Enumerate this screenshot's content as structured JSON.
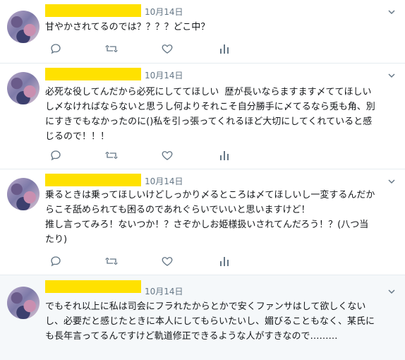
{
  "tweets": [
    {
      "date": "10月14日",
      "text": "甘やかされてるのでは？？？？どこ中？"
    },
    {
      "date": "10月14日",
      "text": "必死な役してんだから必死にしててほしい  歴が長いならますます〆ててほしい\nし〆なければならないと思うし何よりそれこそ自分勝手に〆てるなら兎も角、別\nにすきでもなかったのに()私を引っ張ってくれるほど大切にしてくれていると感\nじるので！！！"
    },
    {
      "date": "10月14日",
      "text": "乗るときは乗ってほしいけどしっかり〆るところは〆てほしいし一変するんだか\nらこそ舐められても困るのであれぐらいでいいと思いますけど！\n推し言ってみろ！ないつか！？さぞかしお姫様扱いされてんだろう！？(八つ当\nたり)"
    },
    {
      "date": "10月14日",
      "text": "でもそれ以上に私は司会にフラれたからとかで安くファンサはして欲しくない\nし、必要だと感じたときに本人にしてもらいたいし、媚びることもなく、某氏に\nも長年言ってるんですけど軌道修正できるような人がすきなので………"
    }
  ],
  "icons": {
    "reply": "reply-icon",
    "retweet": "retweet-icon",
    "like": "like-icon",
    "analytics": "analytics-icon",
    "menu": "chevron-down-icon"
  },
  "colors": {
    "name_redaction": "#ffe100",
    "icon": "#657786",
    "border": "#e6ecf0",
    "highlight_bg": "#f5f8fa"
  }
}
